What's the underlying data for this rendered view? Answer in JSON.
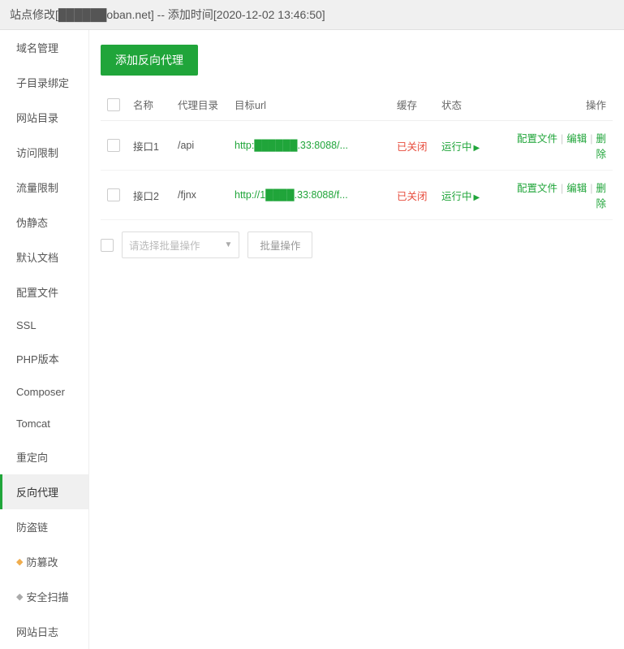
{
  "header": {
    "title": "站点修改[██████oban.net] -- 添加时间[2020-12-02 13:46:50]"
  },
  "sidebar": {
    "items": [
      {
        "label": "域名管理",
        "icon": ""
      },
      {
        "label": "子目录绑定",
        "icon": ""
      },
      {
        "label": "网站目录",
        "icon": ""
      },
      {
        "label": "访问限制",
        "icon": ""
      },
      {
        "label": "流量限制",
        "icon": ""
      },
      {
        "label": "伪静态",
        "icon": ""
      },
      {
        "label": "默认文档",
        "icon": ""
      },
      {
        "label": "配置文件",
        "icon": ""
      },
      {
        "label": "SSL",
        "icon": ""
      },
      {
        "label": "PHP版本",
        "icon": ""
      },
      {
        "label": "Composer",
        "icon": ""
      },
      {
        "label": "Tomcat",
        "icon": ""
      },
      {
        "label": "重定向",
        "icon": ""
      },
      {
        "label": "反向代理",
        "icon": "",
        "active": true
      },
      {
        "label": "防盗链",
        "icon": ""
      },
      {
        "label": "防篡改",
        "icon": "gem-orange"
      },
      {
        "label": "安全扫描",
        "icon": "gem-gray"
      },
      {
        "label": "网站日志",
        "icon": ""
      }
    ]
  },
  "main": {
    "add_btn": "添加反向代理",
    "headers": {
      "name": "名称",
      "dir": "代理目录",
      "url": "目标url",
      "cache": "缓存",
      "state": "状态",
      "ops": "操作"
    },
    "rows": [
      {
        "name": "接口1",
        "dir": "/api",
        "url": "http:██████.33:8088/...",
        "cache": "已关闭",
        "state": "运行中"
      },
      {
        "name": "接口2",
        "dir": "/fjnx",
        "url": "http://1████.33:8088/f...",
        "cache": "已关闭",
        "state": "运行中"
      }
    ],
    "actions": {
      "config": "配置文件",
      "edit": "编辑",
      "delete": "删除"
    },
    "bulk": {
      "placeholder": "请选择批量操作",
      "btn": "批量操作"
    }
  }
}
